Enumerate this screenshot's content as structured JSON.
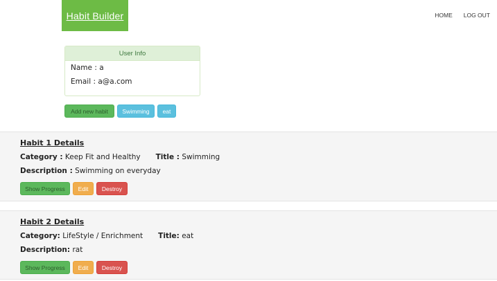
{
  "brand": {
    "label": "Habit Builder"
  },
  "nav": {
    "home": "HOME",
    "logout": "LOG OUT"
  },
  "user_info": {
    "heading": "User Info",
    "name_label": "Name :",
    "name_value": "a",
    "email_label": "Email :",
    "email_value": "a@a.com"
  },
  "habit_buttons": {
    "add": "Add new habit",
    "items": [
      "Swimming",
      "eat"
    ]
  },
  "habits": [
    {
      "title": "Habit 1 Details",
      "category_label": "Category :",
      "category_value": "Keep Fit and Healthy",
      "title_label": "Title :",
      "title_value": "Swimming",
      "description_label": "Description :",
      "description_value": "Swimming on everyday",
      "show_progress": "Show Progress",
      "edit": "Edit",
      "destroy": "Destroy"
    },
    {
      "title": "Habit 2 Details",
      "category_label": "Category:",
      "category_value": "LifeStyle / Enrichment",
      "title_label": "Title:",
      "title_value": "eat",
      "description_label": "Description:",
      "description_value": "rat",
      "show_progress": "Show Progress",
      "edit": "Edit",
      "destroy": "Destroy"
    }
  ],
  "colors": {
    "brand": "#6dbb45",
    "success": "#5cb85c",
    "info": "#5bc0de",
    "warning": "#f0ad4e",
    "danger": "#d9534f",
    "panel_header": "#dff0d8"
  }
}
